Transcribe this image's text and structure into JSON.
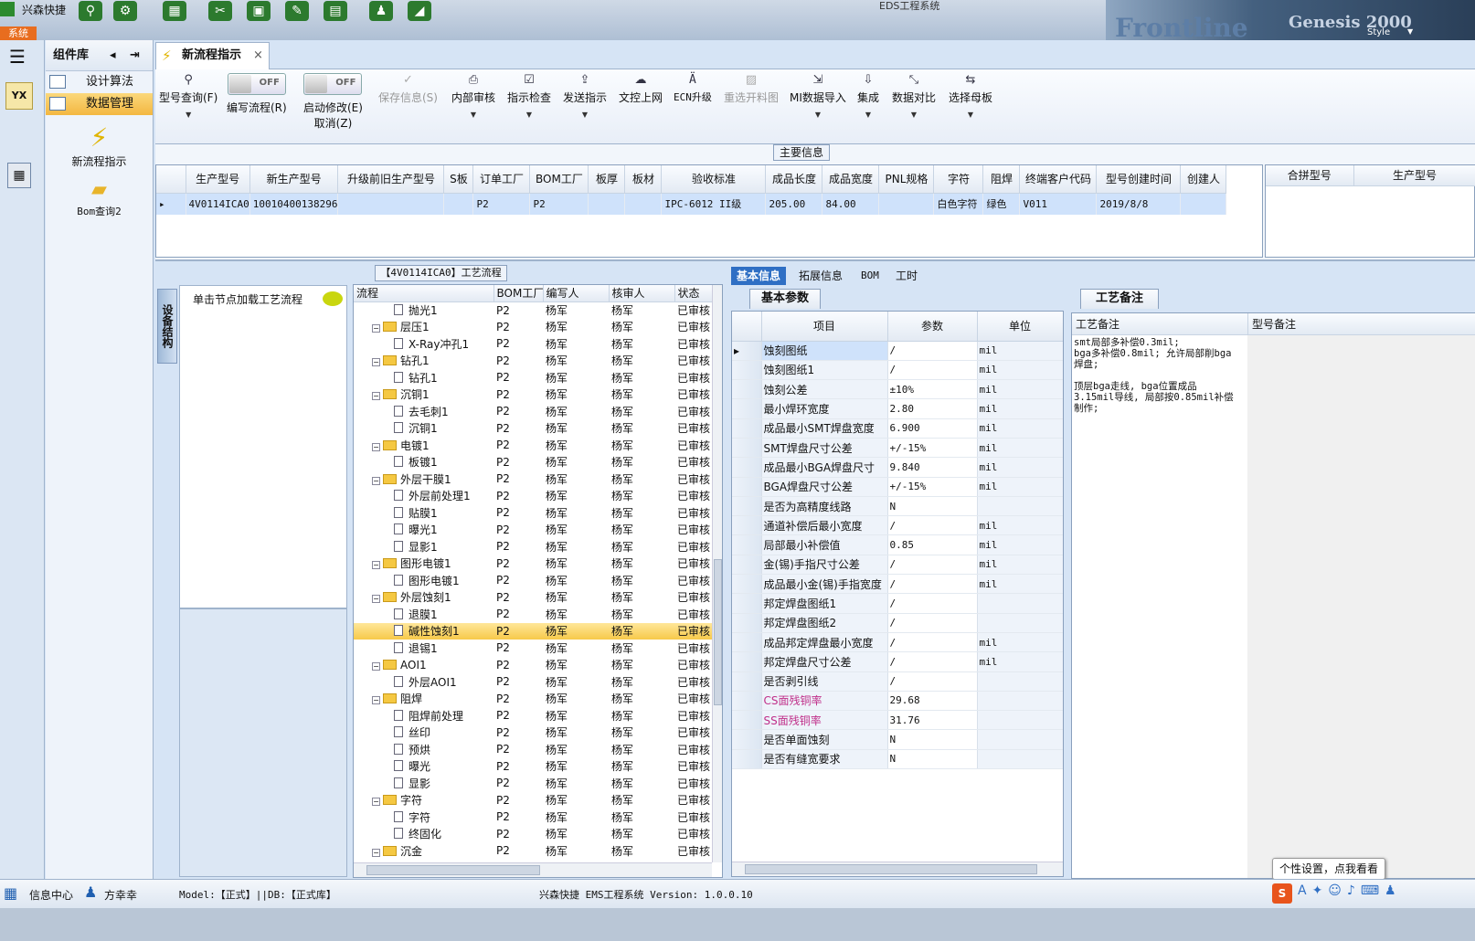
{
  "titlebar": {
    "app_name": "兴森快捷",
    "window_title": "EDS工程系统",
    "system_menu": "系统",
    "style_label": "Style"
  },
  "components": {
    "header": "组件库",
    "items": [
      {
        "label": "设计算法"
      },
      {
        "label": "数据管理"
      }
    ],
    "tools": [
      {
        "label": "新流程指示"
      },
      {
        "label": "Bom查询2"
      }
    ]
  },
  "tab": {
    "label": "新流程指示"
  },
  "toolbar": {
    "model_query": "型号查询(F)",
    "write_flow": "编写流程(R)",
    "start_modify": "启动修改(E)",
    "cancel": "取消(Z)",
    "toggle_off": "OFF",
    "save_info": "保存信息(S)",
    "internal_review": "内部审核",
    "instruction_check": "指示检查",
    "send_instruction": "发送指示",
    "doc_upload": "文控上网",
    "ecn_upgrade": "ECN升级",
    "reselect_image": "重选开料图",
    "mi_import": "MI数据导入",
    "integrate": "集成",
    "data_compare": "数据对比",
    "select_master": "选择母板"
  },
  "main_info": {
    "caption": "主要信息",
    "columns": [
      "生产型号",
      "新生产型号",
      "升级前旧生产型号",
      "S板",
      "订单工厂",
      "BOM工厂",
      "板厚",
      "板材",
      "验收标准",
      "成品长度",
      "成品宽度",
      "PNL规格",
      "字符",
      "阻焊",
      "终端客户代码",
      "型号创建时间",
      "创建人"
    ],
    "row": [
      "4V0114ICA0",
      "10010400138296",
      "",
      "",
      "P2",
      "P2",
      "",
      "",
      "IPC-6012 II级",
      "205.00",
      "84.00",
      "",
      "白色字符",
      "绿色",
      "V011",
      "2019/8/8",
      ""
    ],
    "side_columns": [
      "合拼型号",
      "生产型号"
    ]
  },
  "flow": {
    "caption": "【4V0114ICA0】工艺流程",
    "side_tab": "设备结构",
    "node_hint": "单击节点加载工艺流程",
    "columns": [
      "流程",
      "BOM工厂",
      "编写人",
      "核审人",
      "状态"
    ],
    "rows": [
      {
        "name": "抛光1",
        "type": "child",
        "factory": "P2",
        "writer": "杨军",
        "reviewer": "杨军",
        "status": "已审核"
      },
      {
        "name": "层压1",
        "type": "group",
        "factory": "P2",
        "writer": "杨军",
        "reviewer": "杨军",
        "status": "已审核"
      },
      {
        "name": "X-Ray冲孔1",
        "type": "child",
        "factory": "P2",
        "writer": "杨军",
        "reviewer": "杨军",
        "status": "已审核"
      },
      {
        "name": "钻孔1",
        "type": "group",
        "factory": "P2",
        "writer": "杨军",
        "reviewer": "杨军",
        "status": "已审核"
      },
      {
        "name": "钻孔1",
        "type": "child",
        "factory": "P2",
        "writer": "杨军",
        "reviewer": "杨军",
        "status": "已审核"
      },
      {
        "name": "沉铜1",
        "type": "group",
        "factory": "P2",
        "writer": "杨军",
        "reviewer": "杨军",
        "status": "已审核"
      },
      {
        "name": "去毛刺1",
        "type": "child",
        "factory": "P2",
        "writer": "杨军",
        "reviewer": "杨军",
        "status": "已审核"
      },
      {
        "name": "沉铜1",
        "type": "child",
        "factory": "P2",
        "writer": "杨军",
        "reviewer": "杨军",
        "status": "已审核"
      },
      {
        "name": "电镀1",
        "type": "group",
        "factory": "P2",
        "writer": "杨军",
        "reviewer": "杨军",
        "status": "已审核"
      },
      {
        "name": "板镀1",
        "type": "child",
        "factory": "P2",
        "writer": "杨军",
        "reviewer": "杨军",
        "status": "已审核"
      },
      {
        "name": "外层干膜1",
        "type": "group",
        "factory": "P2",
        "writer": "杨军",
        "reviewer": "杨军",
        "status": "已审核"
      },
      {
        "name": "外层前处理1",
        "type": "child",
        "factory": "P2",
        "writer": "杨军",
        "reviewer": "杨军",
        "status": "已审核"
      },
      {
        "name": "贴膜1",
        "type": "child",
        "factory": "P2",
        "writer": "杨军",
        "reviewer": "杨军",
        "status": "已审核"
      },
      {
        "name": "曝光1",
        "type": "child",
        "factory": "P2",
        "writer": "杨军",
        "reviewer": "杨军",
        "status": "已审核"
      },
      {
        "name": "显影1",
        "type": "child",
        "factory": "P2",
        "writer": "杨军",
        "reviewer": "杨军",
        "status": "已审核"
      },
      {
        "name": "图形电镀1",
        "type": "group",
        "factory": "P2",
        "writer": "杨军",
        "reviewer": "杨军",
        "status": "已审核"
      },
      {
        "name": "图形电镀1",
        "type": "child",
        "factory": "P2",
        "writer": "杨军",
        "reviewer": "杨军",
        "status": "已审核"
      },
      {
        "name": "外层蚀刻1",
        "type": "group",
        "factory": "P2",
        "writer": "杨军",
        "reviewer": "杨军",
        "status": "已审核"
      },
      {
        "name": "退膜1",
        "type": "child",
        "factory": "P2",
        "writer": "杨军",
        "reviewer": "杨军",
        "status": "已审核"
      },
      {
        "name": "碱性蚀刻1",
        "type": "child",
        "factory": "P2",
        "writer": "杨军",
        "reviewer": "杨军",
        "status": "已审核",
        "selected": true
      },
      {
        "name": "退锡1",
        "type": "child",
        "factory": "P2",
        "writer": "杨军",
        "reviewer": "杨军",
        "status": "已审核"
      },
      {
        "name": "AOI1",
        "type": "group",
        "factory": "P2",
        "writer": "杨军",
        "reviewer": "杨军",
        "status": "已审核"
      },
      {
        "name": "外层AOI1",
        "type": "child",
        "factory": "P2",
        "writer": "杨军",
        "reviewer": "杨军",
        "status": "已审核"
      },
      {
        "name": "阻焊",
        "type": "group",
        "factory": "P2",
        "writer": "杨军",
        "reviewer": "杨军",
        "status": "已审核"
      },
      {
        "name": "阻焊前处理",
        "type": "child",
        "factory": "P2",
        "writer": "杨军",
        "reviewer": "杨军",
        "status": "已审核"
      },
      {
        "name": "丝印",
        "type": "child",
        "factory": "P2",
        "writer": "杨军",
        "reviewer": "杨军",
        "status": "已审核"
      },
      {
        "name": "预烘",
        "type": "child",
        "factory": "P2",
        "writer": "杨军",
        "reviewer": "杨军",
        "status": "已审核"
      },
      {
        "name": "曝光",
        "type": "child",
        "factory": "P2",
        "writer": "杨军",
        "reviewer": "杨军",
        "status": "已审核"
      },
      {
        "name": "显影",
        "type": "child",
        "factory": "P2",
        "writer": "杨军",
        "reviewer": "杨军",
        "status": "已审核"
      },
      {
        "name": "字符",
        "type": "group",
        "factory": "P2",
        "writer": "杨军",
        "reviewer": "杨军",
        "status": "已审核"
      },
      {
        "name": "字符",
        "type": "child",
        "factory": "P2",
        "writer": "杨军",
        "reviewer": "杨军",
        "status": "已审核"
      },
      {
        "name": "终固化",
        "type": "child",
        "factory": "P2",
        "writer": "杨军",
        "reviewer": "杨军",
        "status": "已审核"
      },
      {
        "name": "沉金",
        "type": "group",
        "factory": "P2",
        "writer": "杨军",
        "reviewer": "杨军",
        "status": "已审核"
      }
    ]
  },
  "info_tabs": [
    "基本信息",
    "拓展信息",
    "BOM",
    "工时"
  ],
  "params": {
    "header": "基本参数",
    "columns": [
      "项目",
      "参数",
      "单位"
    ],
    "rows": [
      {
        "item": "蚀刻图纸",
        "value": "/",
        "unit": "mil"
      },
      {
        "item": "蚀刻图纸1",
        "value": "/",
        "unit": "mil"
      },
      {
        "item": "蚀刻公差",
        "value": "±10%",
        "unit": "mil"
      },
      {
        "item": "最小焊环宽度",
        "value": "2.80",
        "unit": "mil"
      },
      {
        "item": "成品最小SMT焊盘宽度",
        "value": "6.900",
        "unit": "mil"
      },
      {
        "item": "SMT焊盘尺寸公差",
        "value": "+/-15%",
        "unit": "mil"
      },
      {
        "item": "成品最小BGA焊盘尺寸",
        "value": "9.840",
        "unit": "mil"
      },
      {
        "item": "BGA焊盘尺寸公差",
        "value": "+/-15%",
        "unit": "mil"
      },
      {
        "item": "是否为高精度线路",
        "value": "N",
        "unit": ""
      },
      {
        "item": "通道补偿后最小宽度",
        "value": "/",
        "unit": "mil"
      },
      {
        "item": "局部最小补偿值",
        "value": "0.85",
        "unit": "mil"
      },
      {
        "item": "金(锡)手指尺寸公差",
        "value": "/",
        "unit": "mil"
      },
      {
        "item": "成品最小金(锡)手指宽度",
        "value": "/",
        "unit": "mil"
      },
      {
        "item": "邦定焊盘图纸1",
        "value": "/",
        "unit": ""
      },
      {
        "item": "邦定焊盘图纸2",
        "value": "/",
        "unit": ""
      },
      {
        "item": "成品邦定焊盘最小宽度",
        "value": "/",
        "unit": "mil"
      },
      {
        "item": "邦定焊盘尺寸公差",
        "value": "/",
        "unit": "mil"
      },
      {
        "item": "是否剥引线",
        "value": "/",
        "unit": ""
      },
      {
        "item": "CS面残铜率",
        "value": "29.68",
        "unit": "",
        "highlight": true
      },
      {
        "item": "SS面残铜率",
        "value": "31.76",
        "unit": "",
        "highlight": true
      },
      {
        "item": "是否单面蚀刻",
        "value": "N",
        "unit": ""
      },
      {
        "item": "是否有缝宽要求",
        "value": "N",
        "unit": ""
      }
    ]
  },
  "remarks": {
    "header": "工艺备注",
    "col1": "工艺备注",
    "col2": "型号备注",
    "text": "smt局部多补偿0.3mil;\nbga多补偿0.8mil; 允许局部削bga焊盘;\n\n顶层bga走线, bga位置成品3.15mil导线, 局部按0.85mil补偿制作;"
  },
  "tooltip": "个性设置，点我看看",
  "status": {
    "info_center": "信息中心",
    "user": "方幸幸",
    "model_db": "Model:【正式】||DB:【正式库】",
    "version": "兴森快捷 EMS工程系统 Version: 1.0.0.10"
  },
  "colors": {
    "accent": "#2f6fc4",
    "highlight": "#f7c94a",
    "pink": "#c0308a"
  }
}
